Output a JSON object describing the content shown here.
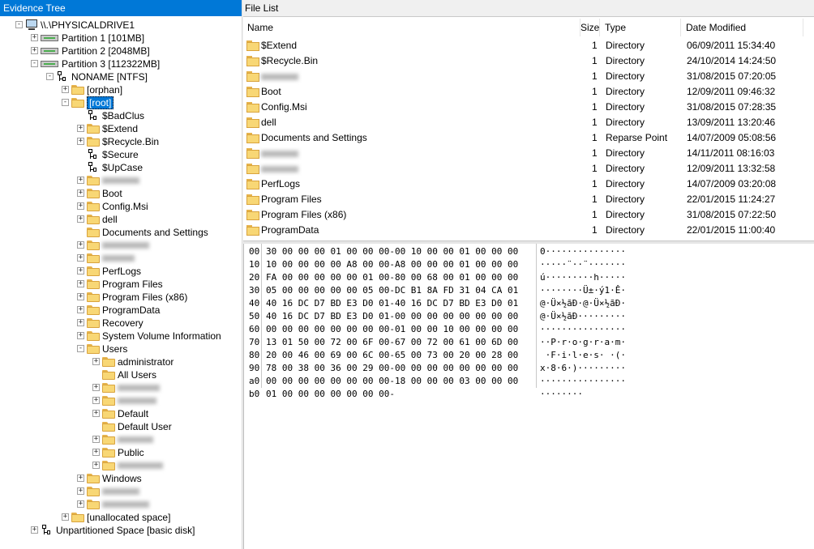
{
  "left_panel": {
    "title": "Evidence Tree",
    "tree": [
      {
        "label": "\\\\.\\PHYSICALDRIVE1",
        "icon": "computer-icon",
        "level": 0,
        "expander": "-"
      },
      {
        "label": "Partition 1 [101MB]",
        "icon": "partition-icon",
        "level": 1,
        "expander": "+"
      },
      {
        "label": "Partition 2 [2048MB]",
        "icon": "partition-icon",
        "level": 1,
        "expander": "+"
      },
      {
        "label": "Partition 3 [112322MB]",
        "icon": "partition-icon",
        "level": 1,
        "expander": "-"
      },
      {
        "label": "NONAME [NTFS]",
        "icon": "filesystem-icon",
        "level": 2,
        "expander": "-"
      },
      {
        "label": "[orphan]",
        "icon": "folder-icon",
        "level": 3,
        "expander": "+"
      },
      {
        "label": "[root]",
        "icon": "folder-icon",
        "level": 3,
        "expander": "-",
        "selected": true
      },
      {
        "label": "$BadClus",
        "icon": "system-file-icon",
        "level": 4,
        "expander": ""
      },
      {
        "label": "$Extend",
        "icon": "folder-icon",
        "level": 4,
        "expander": "+"
      },
      {
        "label": "$Recycle.Bin",
        "icon": "folder-icon",
        "level": 4,
        "expander": "+"
      },
      {
        "label": "$Secure",
        "icon": "system-file-icon",
        "level": 4,
        "expander": ""
      },
      {
        "label": "$UpCase",
        "icon": "system-file-icon",
        "level": 4,
        "expander": ""
      },
      {
        "label": "",
        "icon": "folder-icon",
        "level": 4,
        "expander": "+",
        "redacted": true
      },
      {
        "label": "Boot",
        "icon": "folder-icon",
        "level": 4,
        "expander": "+"
      },
      {
        "label": "Config.Msi",
        "icon": "folder-icon",
        "level": 4,
        "expander": "+"
      },
      {
        "label": "dell",
        "icon": "folder-icon",
        "level": 4,
        "expander": "+"
      },
      {
        "label": "Documents and Settings",
        "icon": "folder-icon",
        "level": 4,
        "expander": ""
      },
      {
        "label": "",
        "icon": "folder-icon",
        "level": 4,
        "expander": "+",
        "redacted": true
      },
      {
        "label": "",
        "icon": "folder-icon",
        "level": 4,
        "expander": "+",
        "redacted": true
      },
      {
        "label": "PerfLogs",
        "icon": "folder-icon",
        "level": 4,
        "expander": "+"
      },
      {
        "label": "Program Files",
        "icon": "folder-icon",
        "level": 4,
        "expander": "+"
      },
      {
        "label": "Program Files (x86)",
        "icon": "folder-icon",
        "level": 4,
        "expander": "+"
      },
      {
        "label": "ProgramData",
        "icon": "folder-icon",
        "level": 4,
        "expander": "+"
      },
      {
        "label": "Recovery",
        "icon": "folder-icon",
        "level": 4,
        "expander": "+"
      },
      {
        "label": "System Volume Information",
        "icon": "folder-icon",
        "level": 4,
        "expander": "+"
      },
      {
        "label": "Users",
        "icon": "folder-icon",
        "level": 4,
        "expander": "-"
      },
      {
        "label": "administrator",
        "icon": "folder-icon",
        "level": 5,
        "expander": "+"
      },
      {
        "label": "All Users",
        "icon": "folder-icon",
        "level": 5,
        "expander": ""
      },
      {
        "label": "",
        "icon": "folder-icon",
        "level": 5,
        "expander": "+",
        "redacted": true
      },
      {
        "label": "",
        "icon": "folder-icon",
        "level": 5,
        "expander": "+",
        "redacted": true
      },
      {
        "label": "Default",
        "icon": "folder-icon",
        "level": 5,
        "expander": "+"
      },
      {
        "label": "Default User",
        "icon": "folder-icon",
        "level": 5,
        "expander": ""
      },
      {
        "label": "",
        "icon": "folder-icon",
        "level": 5,
        "expander": "+",
        "redacted": true
      },
      {
        "label": "Public",
        "icon": "folder-icon",
        "level": 5,
        "expander": "+"
      },
      {
        "label": "",
        "icon": "folder-icon",
        "level": 5,
        "expander": "+",
        "redacted": true
      },
      {
        "label": "Windows",
        "icon": "folder-icon",
        "level": 4,
        "expander": "+"
      },
      {
        "label": "",
        "icon": "folder-icon",
        "level": 4,
        "expander": "+",
        "redacted": true
      },
      {
        "label": "",
        "icon": "folder-icon",
        "level": 4,
        "expander": "+",
        "redacted": true
      },
      {
        "label": "[unallocated space]",
        "icon": "folder-icon",
        "level": 3,
        "expander": "+"
      },
      {
        "label": "Unpartitioned Space [basic disk]",
        "icon": "filesystem-icon",
        "level": 1,
        "expander": "+"
      }
    ]
  },
  "right_panel": {
    "title": "File List",
    "columns": [
      "Name",
      "Size",
      "Type",
      "Date Modified"
    ],
    "files": [
      {
        "name": "$Extend",
        "size": "1",
        "type": "Directory",
        "date": "06/09/2011 15:34:40"
      },
      {
        "name": "$Recycle.Bin",
        "size": "1",
        "type": "Directory",
        "date": "24/10/2014 14:24:50"
      },
      {
        "name": "",
        "size": "1",
        "type": "Directory",
        "date": "31/08/2015 07:20:05",
        "redacted": true
      },
      {
        "name": "Boot",
        "size": "1",
        "type": "Directory",
        "date": "12/09/2011 09:46:32"
      },
      {
        "name": "Config.Msi",
        "size": "1",
        "type": "Directory",
        "date": "31/08/2015 07:28:35"
      },
      {
        "name": "dell",
        "size": "1",
        "type": "Directory",
        "date": "13/09/2011 13:20:46"
      },
      {
        "name": "Documents and Settings",
        "size": "1",
        "type": "Reparse Point",
        "date": "14/07/2009 05:08:56"
      },
      {
        "name": "",
        "size": "1",
        "type": "Directory",
        "date": "14/11/2011 08:16:03",
        "redacted": true
      },
      {
        "name": "",
        "size": "1",
        "type": "Directory",
        "date": "12/09/2011 13:32:58",
        "redacted": true
      },
      {
        "name": "PerfLogs",
        "size": "1",
        "type": "Directory",
        "date": "14/07/2009 03:20:08"
      },
      {
        "name": "Program Files",
        "size": "1",
        "type": "Directory",
        "date": "22/01/2015 11:24:27"
      },
      {
        "name": "Program Files (x86)",
        "size": "1",
        "type": "Directory",
        "date": "31/08/2015 07:22:50"
      },
      {
        "name": "ProgramData",
        "size": "1",
        "type": "Directory",
        "date": "22/01/2015 11:00:40"
      }
    ]
  },
  "hex_view": {
    "rows": [
      {
        "offset": "00",
        "bytes": "30 00 00 00 01 00 00 00-00 10 00 00 01 00 00 00",
        "ascii": "0···············"
      },
      {
        "offset": "10",
        "bytes": "10 00 00 00 00 A8 00 00-A8 00 00 00 01 00 00 00",
        "ascii": "·····¨··¨·······"
      },
      {
        "offset": "20",
        "bytes": "FA 00 00 00 00 00 01 00-80 00 68 00 01 00 00 00",
        "ascii": "ú·········h·····"
      },
      {
        "offset": "30",
        "bytes": "05 00 00 00 00 00 05 00-DC B1 8A FD 31 04 CA 01",
        "ascii": "········Ü±·ý1·Ê·"
      },
      {
        "offset": "40",
        "bytes": "40 16 DC D7 BD E3 D0 01-40 16 DC D7 BD E3 D0 01",
        "ascii": "@·Ü×½ãÐ·@·Ü×½ãÐ·"
      },
      {
        "offset": "50",
        "bytes": "40 16 DC D7 BD E3 D0 01-00 00 00 00 00 00 00 00",
        "ascii": "@·Ü×½ãÐ·········"
      },
      {
        "offset": "60",
        "bytes": "00 00 00 00 00 00 00 00-01 00 00 10 00 00 00 00",
        "ascii": "················"
      },
      {
        "offset": "70",
        "bytes": "13 01 50 00 72 00 6F 00-67 00 72 00 61 00 6D 00",
        "ascii": "··P·r·o·g·r·a·m·"
      },
      {
        "offset": "80",
        "bytes": "20 00 46 00 69 00 6C 00-65 00 73 00 20 00 28 00",
        "ascii": " ·F·i·l·e·s· ·(·"
      },
      {
        "offset": "90",
        "bytes": "78 00 38 00 36 00 29 00-00 00 00 00 00 00 00 00",
        "ascii": "x·8·6·)·········"
      },
      {
        "offset": "a0",
        "bytes": "00 00 00 00 00 00 00 00-18 00 00 00 03 00 00 00",
        "ascii": "················"
      },
      {
        "offset": "b0",
        "bytes": "01 00 00 00 00 00 00 00-",
        "ascii": "········"
      }
    ]
  },
  "colors": {
    "selection": "#0078d7",
    "folder": "#f8d775",
    "title_bar": "#0078d7"
  }
}
